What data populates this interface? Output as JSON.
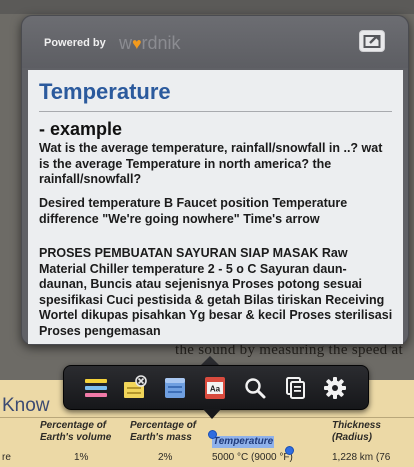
{
  "popup": {
    "powered_by": "Powered by",
    "brand": {
      "text": "wordnik",
      "mark": "♥"
    },
    "share_icon": "share-icon",
    "word": "Temperature",
    "example_label": "- example",
    "examples": [
      "Wat is the average temperature, rainfall/snowfall in ..? wat is the average Temperature in north america? the rainfall/snowfall?",
      "Desired temperature B Faucet position Temperature difference \"We're going nowhere\" Time's arrow",
      "PROSES PEMBUATAN SAYURAN SIAP MASAK Raw Material Chiller temperature 2 - 5 o C Sayuran daun-daunan, Buncis atau sejenisnya Proses potong sesuai spesifikasi Cuci pestisida & getah Bilas tiriskan Receiving Wortel dikupas pisahkan Yg besar & kecil Proses sterilisasi Proses pengemasan"
    ]
  },
  "background": {
    "peek_line": "the sound by measuring the speed at",
    "heading": "Know",
    "column_headers": [
      "Percentage of Earth's volume",
      "Percentage of Earth's mass",
      "Temperature",
      "Thickness (Radius)"
    ],
    "row": {
      "label": "re",
      "volume": "1%",
      "mass": "2%",
      "temperature": "5000 °C (9000 °F)",
      "thickness": "1,228 km (76"
    }
  },
  "toolbar": {
    "buttons": [
      "highlight-icon",
      "note-icon",
      "bookmark-icon",
      "dictionary-icon",
      "search-icon",
      "copy-icon",
      "settings-icon"
    ]
  },
  "colors": {
    "title_blue": "#2b5a9d",
    "selection_blue": "#8fb1ea",
    "paper": "#ecd9a6"
  }
}
